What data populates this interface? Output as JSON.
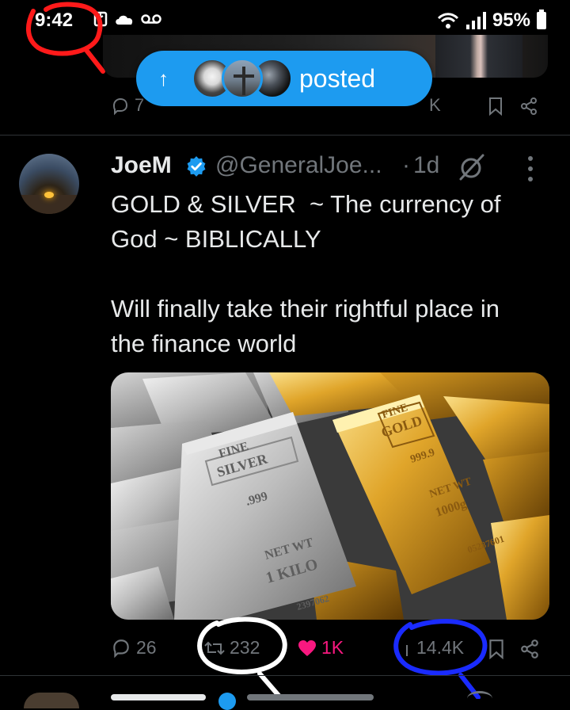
{
  "status_bar": {
    "time": "9:42",
    "battery": "95%"
  },
  "toast": {
    "label": "posted"
  },
  "prev_post_actions": {
    "reply_count": "7",
    "views_count": "K"
  },
  "post": {
    "display_name": "JoeM",
    "handle": "@GeneralJoe...",
    "separator": "·",
    "age": "1d",
    "text": "GOLD & SILVER  ~ The currency of God ~ BIBLICALLY\n\nWill finally take their rightful place in the finance world",
    "media": {
      "silver_text": [
        "FINE",
        "SILVER",
        ".999",
        "NET WT",
        "1 KILO",
        "2397062"
      ],
      "gold_text": [
        "FINE",
        "GOLD",
        "999.9",
        "NET WT",
        "1000g",
        "05287601"
      ]
    },
    "actions": {
      "replies": "26",
      "reposts": "232",
      "likes": "1K",
      "views": "14.4K"
    }
  },
  "colors": {
    "background": "#000000",
    "accent": "#1d9bf0",
    "like": "#f91880",
    "muted": "#71767b",
    "annotation_red": "#ff1a1a",
    "annotation_white": "#ffffff",
    "annotation_blue": "#1a2bff"
  }
}
